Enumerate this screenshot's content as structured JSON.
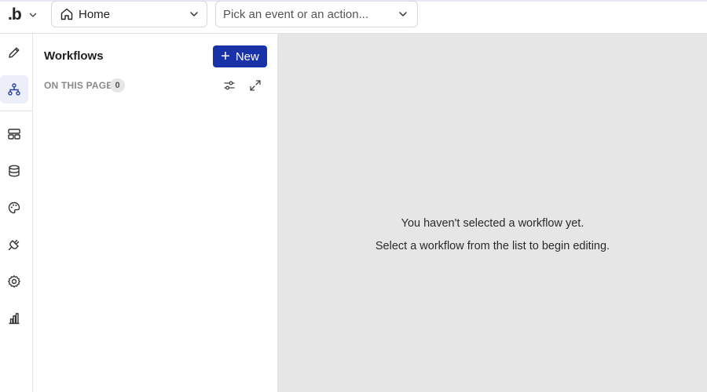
{
  "topbar": {
    "logo": ".b",
    "page_selector": {
      "value": "Home"
    },
    "event_selector": {
      "placeholder": "Pick an event or an action..."
    }
  },
  "rail": {
    "items": [
      {
        "icon": "pencil-icon",
        "active": false
      },
      {
        "icon": "workflow-icon",
        "active": true
      },
      {
        "icon": "layout-icon",
        "active": false
      },
      {
        "icon": "database-icon",
        "active": false
      },
      {
        "icon": "palette-icon",
        "active": false
      },
      {
        "icon": "plug-icon",
        "active": false
      },
      {
        "icon": "gear-icon",
        "active": false
      },
      {
        "icon": "chart-icon",
        "active": false
      }
    ]
  },
  "panel": {
    "title": "Workflows",
    "new_button": {
      "label": "New"
    },
    "section_label": "ON THIS PAGE",
    "count": "0"
  },
  "canvas": {
    "empty_title": "You haven't selected a workflow yet.",
    "empty_hint": "Select a workflow from the list to begin editing."
  },
  "colors": {
    "accent": "#1a32a8",
    "active_rail_bg": "#eceef9",
    "canvas_bg": "#e6e6e6"
  }
}
